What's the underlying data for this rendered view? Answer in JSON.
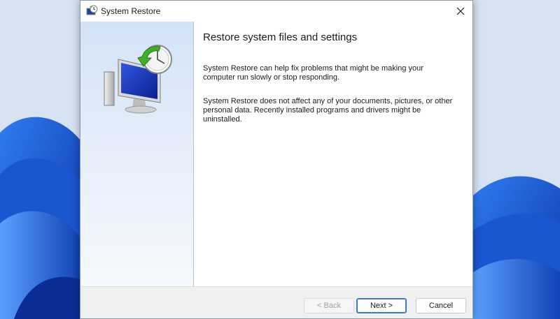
{
  "window": {
    "title": "System Restore",
    "app_icon": "system-restore-icon",
    "close_icon": "close-icon"
  },
  "content": {
    "heading": "Restore system files and settings",
    "paragraph1": "System Restore can help fix problems that might be making your computer run slowly or stop responding.",
    "paragraph2": "System Restore does not affect any of your documents, pictures, or other personal data. Recently installed programs and drivers might be uninstalled."
  },
  "footer": {
    "back_label": "< Back",
    "next_label": "Next >",
    "cancel_label": "Cancel"
  },
  "colors": {
    "accent": "#3a7bd5",
    "desktop_blue": "#1553c8"
  }
}
